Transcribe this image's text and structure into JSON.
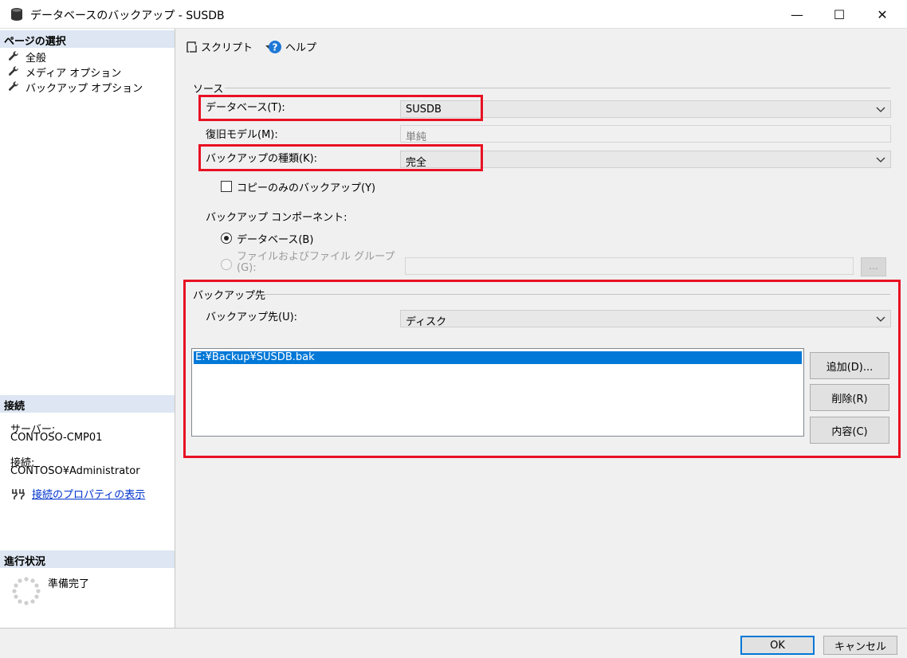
{
  "window": {
    "title": "データベースのバックアップ - SUSDB",
    "minimize_glyph": "—",
    "maximize_glyph": "☐",
    "close_glyph": "✕"
  },
  "left": {
    "page_select_header": "ページの選択",
    "pages": [
      {
        "label": "全般",
        "icon": "wrench-icon"
      },
      {
        "label": "メディア オプション",
        "icon": "wrench-icon"
      },
      {
        "label": "バックアップ オプション",
        "icon": "wrench-icon"
      }
    ],
    "connection_header": "接続",
    "server_label": "サーバー:",
    "server_value": "CONTOSO-CMP01",
    "connection_label": "接続:",
    "connection_value": "CONTOSO¥Administrator",
    "connection_link": "接続のプロパティの表示",
    "progress_header": "進行状況",
    "progress_status": "準備完了"
  },
  "toolbar": {
    "script_label": "スクリプト",
    "help_label": "ヘルプ"
  },
  "source": {
    "group_label": "ソース",
    "database_label": "データベース(T):",
    "database_value": "SUSDB",
    "recovery_label": "復旧モデル(M):",
    "recovery_value": "単純",
    "backup_type_label": "バックアップの種類(K):",
    "backup_type_value": "完全",
    "copy_only_label": "コピーのみのバックアップ(Y)",
    "copy_only_checked": false,
    "component_label": "バックアップ コンポーネント:",
    "component_database_label": "データベース(B)",
    "component_files_label_line1": "ファイルおよびファイル グループ",
    "component_files_label_line2": "(G):",
    "files_browse_label": "..."
  },
  "destination": {
    "group_label": "バックアップ先",
    "dest_label": "バックアップ先(U):",
    "dest_value": "ディスク",
    "files": [
      "E:¥Backup¥SUSDB.bak"
    ],
    "add_button": "追加(D)...",
    "remove_button": "削除(R)",
    "contents_button": "内容(C)"
  },
  "footer": {
    "ok_button": "OK",
    "cancel_button": "キャンセル"
  },
  "colors": {
    "highlight_border": "#e81123",
    "selection": "#0078d7",
    "link": "#0033cc",
    "panel_header": "#dde6f2"
  }
}
